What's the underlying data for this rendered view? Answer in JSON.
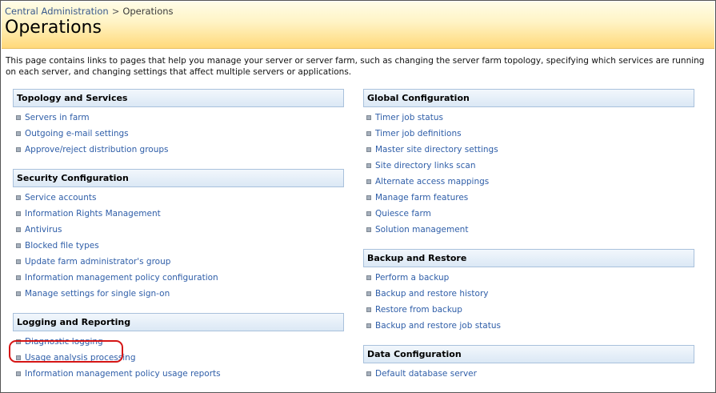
{
  "breadcrumb": {
    "parent": "Central Administration",
    "separator": ">",
    "current": "Operations"
  },
  "page_title": "Operations",
  "description": "This page contains links to pages that help you manage your server or server farm, such as changing the server farm topology, specifying which services are running on each server, and changing settings that affect multiple servers or applications.",
  "left_column": [
    {
      "title": "Topology and Services",
      "links": [
        "Servers in farm",
        "Outgoing e-mail settings",
        "Approve/reject distribution groups"
      ]
    },
    {
      "title": "Security Configuration",
      "links": [
        "Service accounts",
        "Information Rights Management",
        "Antivirus",
        "Blocked file types",
        "Update farm administrator's group",
        "Information management policy configuration",
        "Manage settings for single sign-on"
      ]
    },
    {
      "title": "Logging and Reporting",
      "links": [
        "Diagnostic logging",
        "Usage analysis processing",
        "Information management policy usage reports"
      ]
    }
  ],
  "right_column": [
    {
      "title": "Global Configuration",
      "links": [
        "Timer job status",
        "Timer job definitions",
        "Master site directory settings",
        "Site directory links scan",
        "Alternate access mappings",
        "Manage farm features",
        "Quiesce farm",
        "Solution management"
      ]
    },
    {
      "title": "Backup and Restore",
      "links": [
        "Perform a backup",
        "Backup and restore history",
        "Restore from backup",
        "Backup and restore job status"
      ]
    },
    {
      "title": "Data Configuration",
      "links": [
        "Default database server"
      ]
    }
  ],
  "highlighted_link": "Diagnostic logging",
  "colors": {
    "link": "#2f5ea8",
    "header_border": "#a9c1dc",
    "title_band": "#ffd97a",
    "highlight": "#d51515"
  }
}
